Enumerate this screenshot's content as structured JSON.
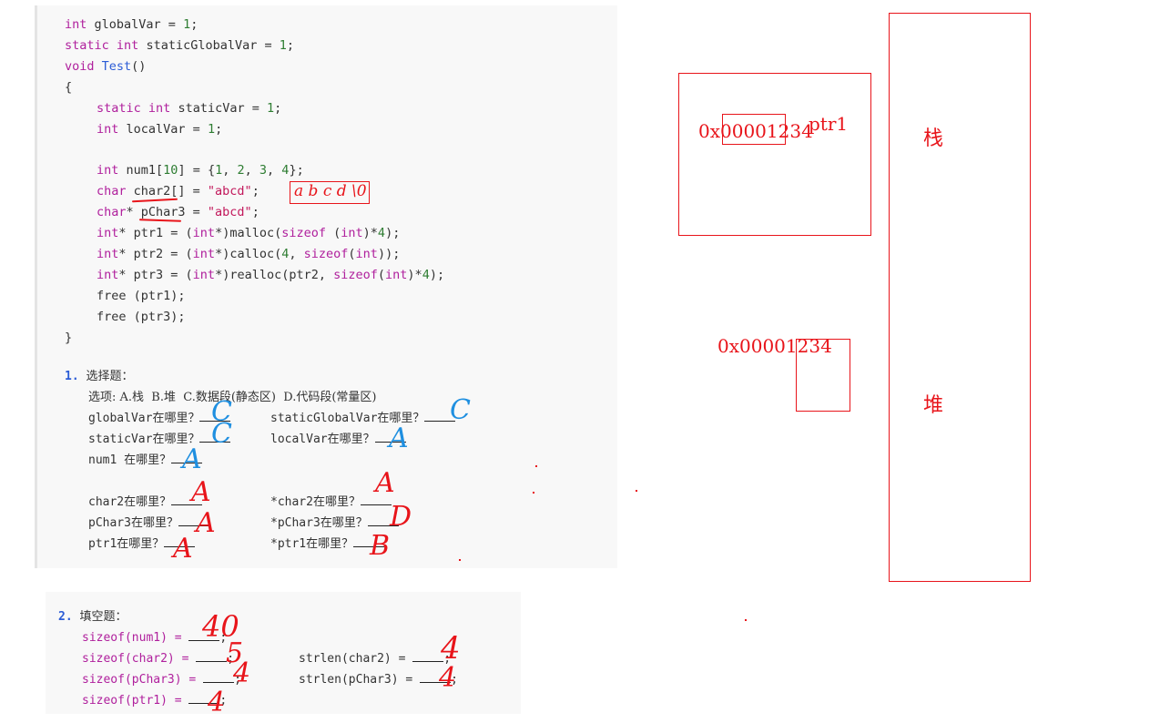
{
  "code": {
    "lines": [
      "int globalVar = 1;",
      "static int staticGlobalVar = 1;",
      "void Test()",
      "{",
      "static int staticVar = 1;",
      "int localVar = 1;",
      "int num1[10] = {1, 2, 3, 4};",
      "char char2[] = \"abcd\";",
      "char* pChar3 = \"abcd\";",
      "int* ptr1 = (int*)malloc(sizeof (int)*4);",
      "int* ptr2 = (int*)calloc(4, sizeof(int));",
      "int* ptr3 = (int*)realloc(ptr2, sizeof(int)*4);",
      "free (ptr1);",
      "free (ptr3);",
      "}"
    ]
  },
  "choice": {
    "title_num": "1.",
    "title": "选择题：",
    "options": "选项: A.栈  B.堆  C.数据段(静态区)  D.代码段(常量区)",
    "items": [
      {
        "label": "globalVar在哪里？",
        "answer": "C",
        "color": "blue"
      },
      {
        "label": "staticGlobalVar在哪里？",
        "answer": "C",
        "color": "blue"
      },
      {
        "label": "staticVar在哪里？",
        "answer": "C",
        "color": "blue"
      },
      {
        "label": "localVar在哪里？",
        "answer": "A",
        "color": "blue"
      },
      {
        "label": "num1 在哪里？",
        "answer": "A",
        "color": "blue"
      },
      {
        "label": "char2在哪里？",
        "answer": "A",
        "color": "red"
      },
      {
        "label": "*char2在哪里？",
        "answer": "A",
        "color": "red"
      },
      {
        "label": "pChar3在哪里？",
        "answer": "A",
        "color": "red"
      },
      {
        "label": "*pChar3在哪里？",
        "answer": "D",
        "color": "red"
      },
      {
        "label": "ptr1在哪里？",
        "answer": "A",
        "color": "red"
      },
      {
        "label": "*ptr1在哪里？",
        "answer": "B",
        "color": "red"
      }
    ]
  },
  "blanks": {
    "title_num": "2.",
    "title": "填空题：",
    "items": [
      {
        "expr": "sizeof(num1) =",
        "answer": "40"
      },
      {
        "expr": "sizeof(char2) =",
        "answer": "5"
      },
      {
        "expr": "strlen(char2) =",
        "answer": "4"
      },
      {
        "expr": "sizeof(pChar3) =",
        "answer": "4"
      },
      {
        "expr": "strlen(pChar3) =",
        "answer": "4"
      },
      {
        "expr": "sizeof(ptr1) =",
        "answer": "4"
      }
    ]
  },
  "annotations": {
    "abcd_box": "a b c d \\0",
    "stack_addr": "0x00001234",
    "stack_var": "ptr1",
    "heap_addr": "0x00001234",
    "stack_label": "栈",
    "heap_label": "堆"
  },
  "colors": {
    "annotation_red": "#e8141a",
    "annotation_blue": "#1f8fe0",
    "keyword": "#b0209d",
    "function": "#2b5cd6",
    "number": "#2e7d32",
    "string": "#c2185b"
  }
}
